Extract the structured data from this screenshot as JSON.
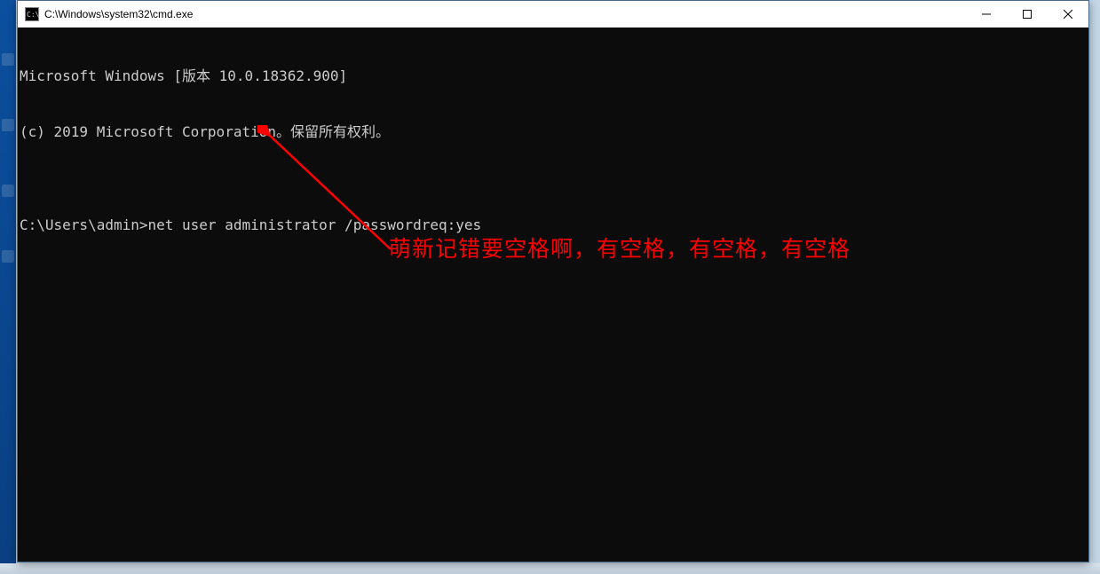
{
  "window": {
    "title": "C:\\Windows\\system32\\cmd.exe"
  },
  "terminal": {
    "line1": "Microsoft Windows [版本 10.0.18362.900]",
    "line2": "(c) 2019 Microsoft Corporation。保留所有权利。",
    "blank": "",
    "prompt": "C:\\Users\\admin>",
    "command": "net user administrator /passwordreq:yes"
  },
  "annotation": {
    "text": "萌新记错要空格啊，有空格，有空格，有空格",
    "color": "#ff0000"
  }
}
